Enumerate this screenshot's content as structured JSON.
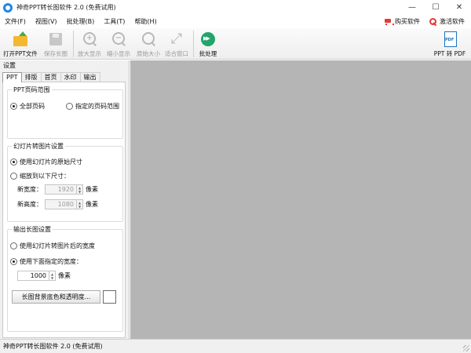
{
  "window": {
    "title": "神奇PPT转长图软件 2.0 (免费试用)",
    "controls": [
      "—",
      "☐",
      "✕"
    ]
  },
  "menu": {
    "items": [
      "文件(F)",
      "视图(V)",
      "批处理(B)",
      "工具(T)",
      "帮助(H)"
    ],
    "buy_label": "购买软件",
    "activate_label": "激活软件"
  },
  "toolbar": {
    "open": "打开PPT文件",
    "save": "保存长图",
    "zoom_in": "放大显示",
    "zoom_out": "缩小显示",
    "original": "原始大小",
    "fit": "适合窗口",
    "batch": "批处理",
    "ppt_to_pdf": "PPT 转 PDF"
  },
  "panel": {
    "title": "设置",
    "tabs": [
      "PPT",
      "排版",
      "首页",
      "水印",
      "输出"
    ],
    "active_tab": "PPT"
  },
  "page_range": {
    "title": "PPT页码范围",
    "all": "全部页码",
    "specified": "指定的页码范围",
    "selected": "all"
  },
  "slide_to_image": {
    "title": "幻灯片转图片设置",
    "original_size": "使用幻灯片的原始尺寸",
    "scale_to": "缩放到以下尺寸：",
    "width_label": "新宽度：",
    "width_value": "1920",
    "height_label": "新高度：",
    "height_value": "1080",
    "unit": "像素",
    "selected": "original_size"
  },
  "output": {
    "title": "输出长图设置",
    "use_slide_width": "使用幻灯片转图片后的宽度",
    "use_specified_width": "使用下面指定的宽度：",
    "width_value": "1000",
    "unit": "像素",
    "selected": "use_specified_width",
    "bg_button": "长图背景底色和透明度...",
    "bg_color": "#ffffff"
  },
  "preview": {
    "background": "#b5b5b5"
  },
  "status": {
    "text": "神奇PPT转长图软件 2.0 (免费试用)"
  }
}
